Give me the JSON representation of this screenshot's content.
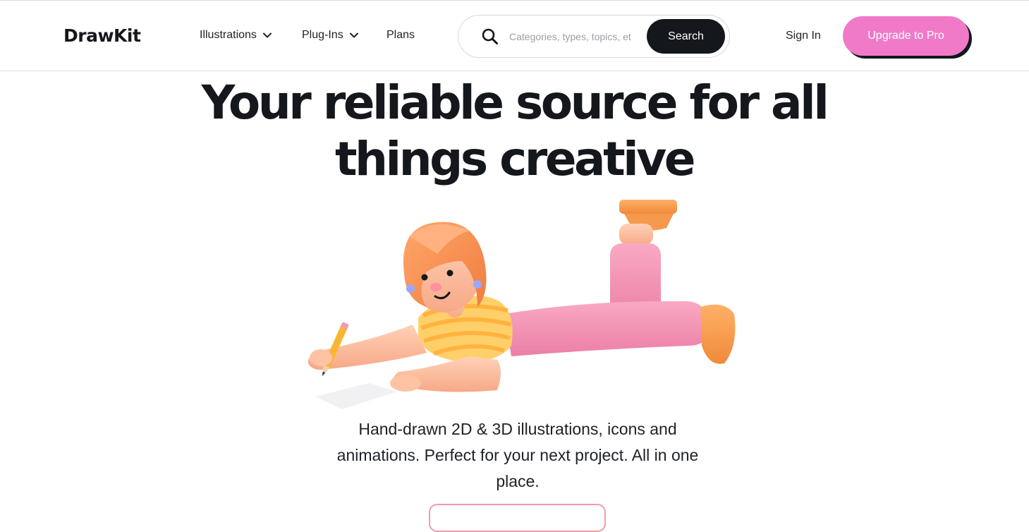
{
  "header": {
    "logo": "DrawKit",
    "nav": [
      {
        "label": "Illustrations",
        "has_dropdown": true
      },
      {
        "label": "Plug-Ins",
        "has_dropdown": true
      },
      {
        "label": "Plans",
        "has_dropdown": false
      }
    ],
    "search": {
      "placeholder": "Categories, types, topics, et",
      "value": "",
      "button_label": "Search",
      "icon": "search-icon"
    },
    "sign_in_label": "Sign In",
    "upgrade_label": "Upgrade to Pro"
  },
  "hero": {
    "title_line1": "Your reliable source for all",
    "title_line2": "things creative",
    "subtitle": "Hand-drawn 2D & 3D illustrations, icons and animations. Perfect for your next project. All in one place.",
    "illustration": "3d-girl-lying-drawing-illustration"
  },
  "colors": {
    "text": "#14171c",
    "accent_pink": "#f07ac8",
    "button_dark": "#14171c",
    "cta_outline": "#f29aa8"
  }
}
